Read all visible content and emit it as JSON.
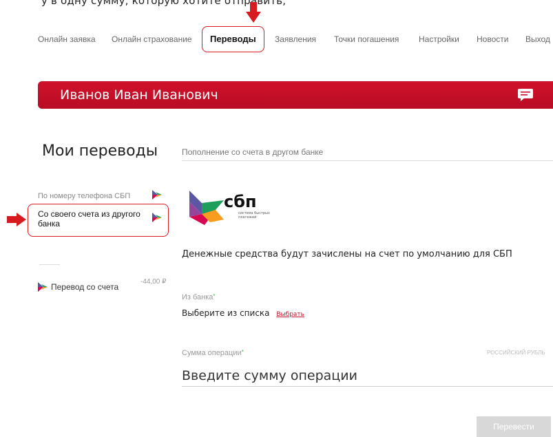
{
  "header": {
    "top_text": "у в одну сумму, которую хотите отправить,"
  },
  "nav": {
    "items": [
      {
        "label": "Онлайн заявка"
      },
      {
        "label": "Онлайн страхование"
      },
      {
        "label": "Переводы"
      },
      {
        "label": "Заявления"
      },
      {
        "label": "Точки погашения"
      },
      {
        "label": "Настройки"
      },
      {
        "label": "Новости"
      },
      {
        "label": "Выход"
      }
    ],
    "active_index": 2
  },
  "banner": {
    "user_name": "Иванов Иван Иванович"
  },
  "sidebar": {
    "title": "Мои переводы",
    "items": [
      {
        "label": "По номеру телефона СБП"
      },
      {
        "label": "Со своего счета из другого банка"
      }
    ],
    "history": {
      "label": "Перевод со счета",
      "amount": "-44,00 ₽"
    }
  },
  "main": {
    "heading": "Пополнение со счета в другом банке",
    "sbp_logo_text": "сбп",
    "sbp_logo_sub1": "система быстрых",
    "sbp_logo_sub2": "платежей",
    "info_text": "Денежные средства будут зачислены на счет по умолчанию для СБП",
    "bank_label": "Из банка",
    "bank_placeholder": "Выберите из списка",
    "bank_link": "Выбрать",
    "amount_label": "Сумма операции",
    "currency": "РОССИЙСКИЙ РУБЛЬ",
    "amount_placeholder": "Введите сумму операции",
    "submit": "Перевести"
  },
  "colors": {
    "brand_red": "#c8102e",
    "accent_green": "#3bb54a"
  }
}
